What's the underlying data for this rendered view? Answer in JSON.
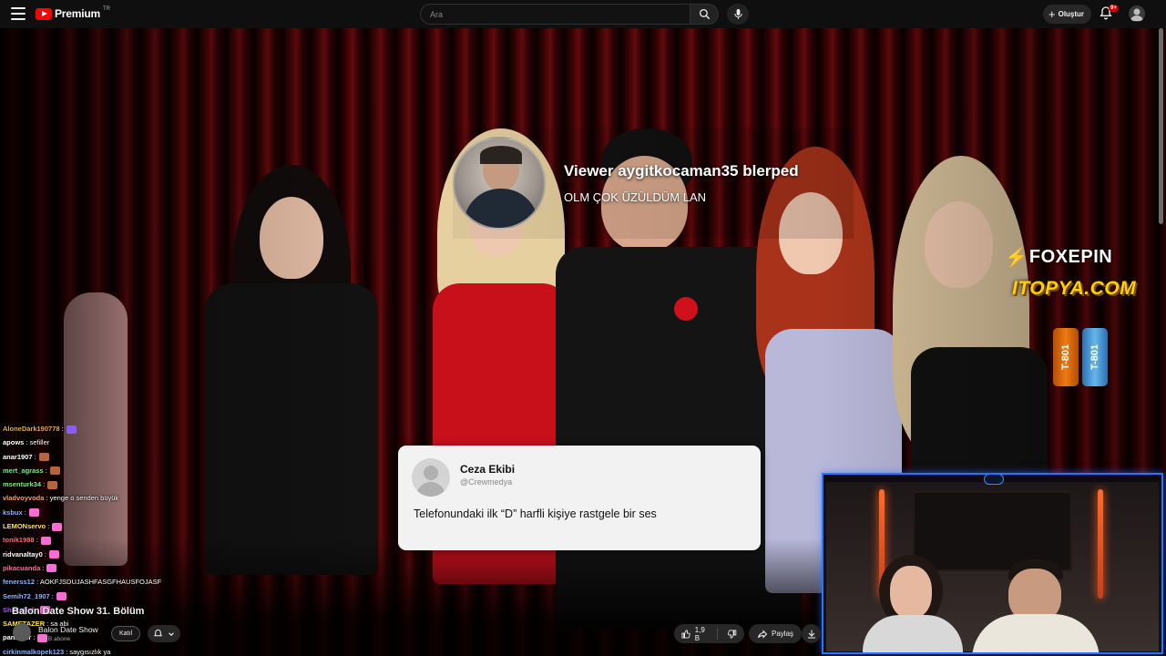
{
  "masthead": {
    "logo_text": "Premium",
    "logo_country": "TR",
    "search_placeholder": "Ara",
    "create_label": "Oluştur",
    "notification_count": "9+"
  },
  "alert": {
    "title": "Viewer aygitkocaman35 blerped",
    "message": "OLM ÇOK ÜZÜLDÜM LAN"
  },
  "sponsors": {
    "foxepin": "FOXEPIN",
    "itopya": "ITOPYA.COM",
    "can_a": "T-801",
    "can_b": "T-801"
  },
  "card": {
    "name": "Ceza Ekibi",
    "handle": "@Crewmedya",
    "text": "Telefonundaki ilk “D” harfli kişiye rastgele bir ses"
  },
  "chat": {
    "lines": [
      {
        "user": "AloneDark190778",
        "msg": " :",
        "color": "#e0a84a",
        "emote": "#8a5cff"
      },
      {
        "user": "apows",
        "msg": " : sefiller",
        "color": "#ffffff",
        "emote": ""
      },
      {
        "user": "anar1907",
        "msg": " :",
        "color": "#ffffff",
        "emote": "#b8643a"
      },
      {
        "user": "mert_agrass",
        "msg": " :",
        "color": "#7cf07c",
        "emote": "#b8643a"
      },
      {
        "user": "msenturk34",
        "msg": " :",
        "color": "#7cf07c",
        "emote": "#b8643a"
      },
      {
        "user": "vladvoyvoda",
        "msg": " : yenge o senden büyük",
        "color": "#ff9a5a",
        "emote": ""
      },
      {
        "user": "ksbux",
        "msg": " :",
        "color": "#8ab4ff",
        "emote": "#ff6bd6"
      },
      {
        "user": "LEMONservo",
        "msg": " :",
        "color": "#ffe14d",
        "emote": "#ff6bd6"
      },
      {
        "user": "tonik1988",
        "msg": " :",
        "color": "#ff6b6b",
        "emote": "#ff6bd6"
      },
      {
        "user": "ridvanaltay0",
        "msg": " :",
        "color": "#ffffff",
        "emote": "#ff6bd6"
      },
      {
        "user": "pikacuanda",
        "msg": " :",
        "color": "#ff6b9a",
        "emote": "#ff6bd6"
      },
      {
        "user": "fenerss12",
        "msg": " : AOKFJSDUJASHFASGFHAUSFOJASF",
        "color": "#8ab4ff",
        "emote": ""
      },
      {
        "user": "Semih72_1907",
        "msg": " :",
        "color": "#8ab4ff",
        "emote": "#ff6bd6"
      },
      {
        "user": "Sheepbnf",
        "msg": " :",
        "color": "#b04bff",
        "emote": "#ff6bd6"
      },
      {
        "user": "SAMETAZER",
        "msg": " : sa abi",
        "color": "#ffe14d",
        "emote": ""
      },
      {
        "user": "panzer1r",
        "msg": " :",
        "color": "#ffffff",
        "emote": "#ff6bd6"
      },
      {
        "user": "cirkinmalkopek123",
        "msg": " : saygısızlık ya",
        "color": "#8ab4ff",
        "emote": ""
      }
    ]
  },
  "video_info": {
    "title": "Balon Date Show 31. Bölüm",
    "channel_name": "Balon Date Show",
    "subscribers": "1,6 B abone",
    "join_label": "Katıl",
    "likes": "1,9 B",
    "share_label": "Paylaş"
  },
  "colors": {
    "accent": "#ff0000",
    "cam_border": "#2b73ff",
    "badge": "#cc0000"
  }
}
